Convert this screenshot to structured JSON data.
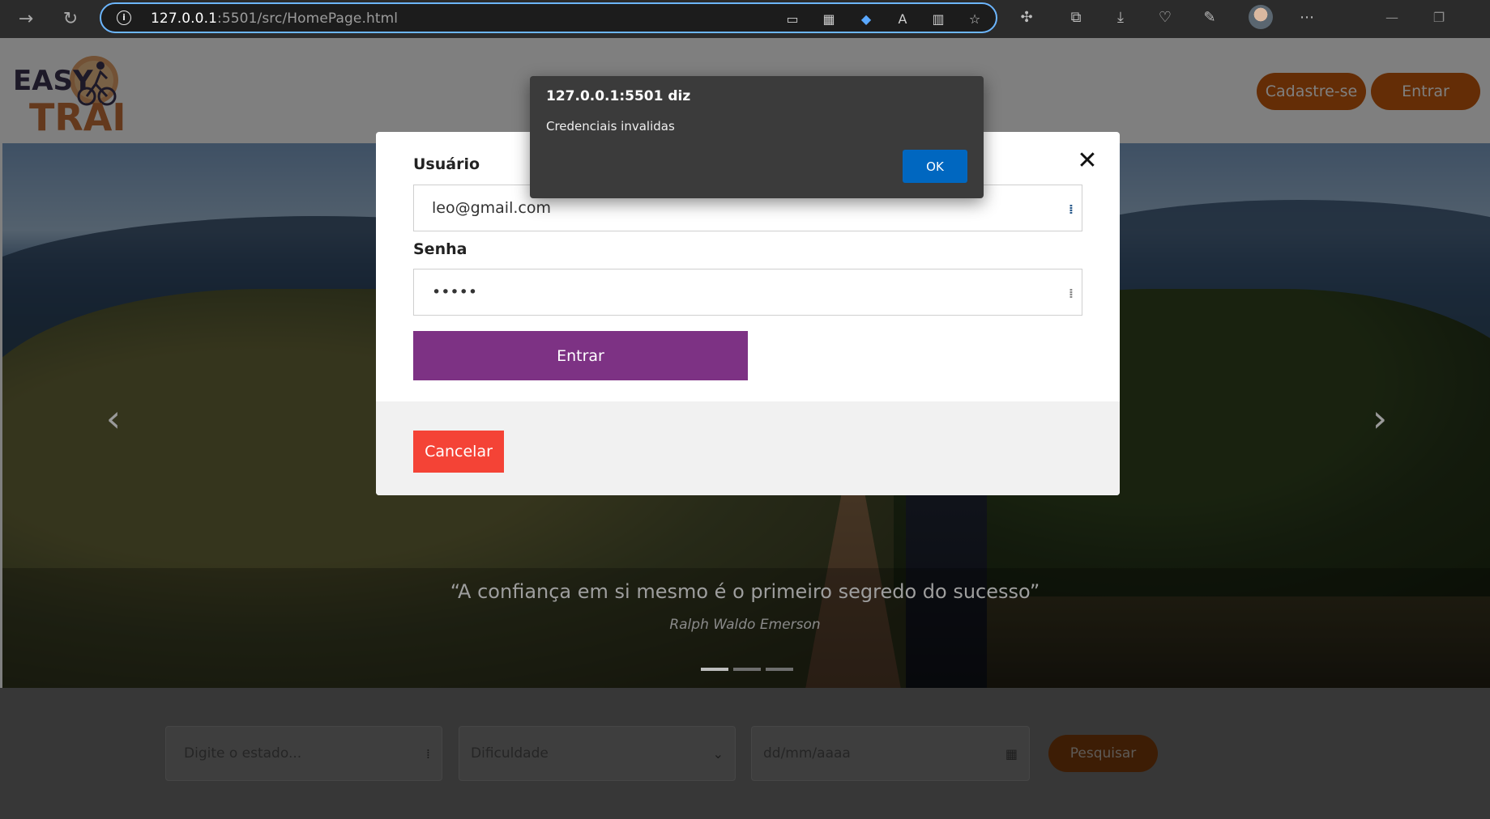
{
  "browser": {
    "url_host": "127.0.0.1",
    "url_rest": ":5501/src/HomePage.html",
    "icons": {
      "back": "arrow-right-icon",
      "refresh": "refresh-icon",
      "info": "info-icon",
      "menu": "more-icon"
    },
    "glyphs": {
      "back": "→",
      "refresh": "↻",
      "info": "i",
      "more": "⋯"
    }
  },
  "header": {
    "logo_text": "EASY TRAIL",
    "signup_label": "Cadastre-se",
    "login_label": "Entrar"
  },
  "hero": {
    "quote": "“A confiança em si mesmo é o primeiro segredo do sucesso”",
    "author": "Ralph Waldo Emerson",
    "slides": 3,
    "active_slide": 1
  },
  "search": {
    "state_placeholder": "Digite o estado...",
    "difficulty_label": "Dificuldade",
    "date_placeholder": "dd/mm/aaaa",
    "submit_label": "Pesquisar"
  },
  "login_modal": {
    "user_label": "Usuário",
    "user_value": "leo@gmail.com",
    "password_label": "Senha",
    "password_value": "•••••",
    "submit_label": "Entrar",
    "cancel_label": "Cancelar",
    "close_glyph": "✕"
  },
  "alert": {
    "title": "127.0.0.1:5501 diz",
    "message": "Credenciais invalidas",
    "ok_label": "OK"
  },
  "colors": {
    "brand_orange": "#c95a0c",
    "login_purple": "#7d3284",
    "cancel_red": "#f44336",
    "alert_ok_blue": "#0067c0"
  }
}
